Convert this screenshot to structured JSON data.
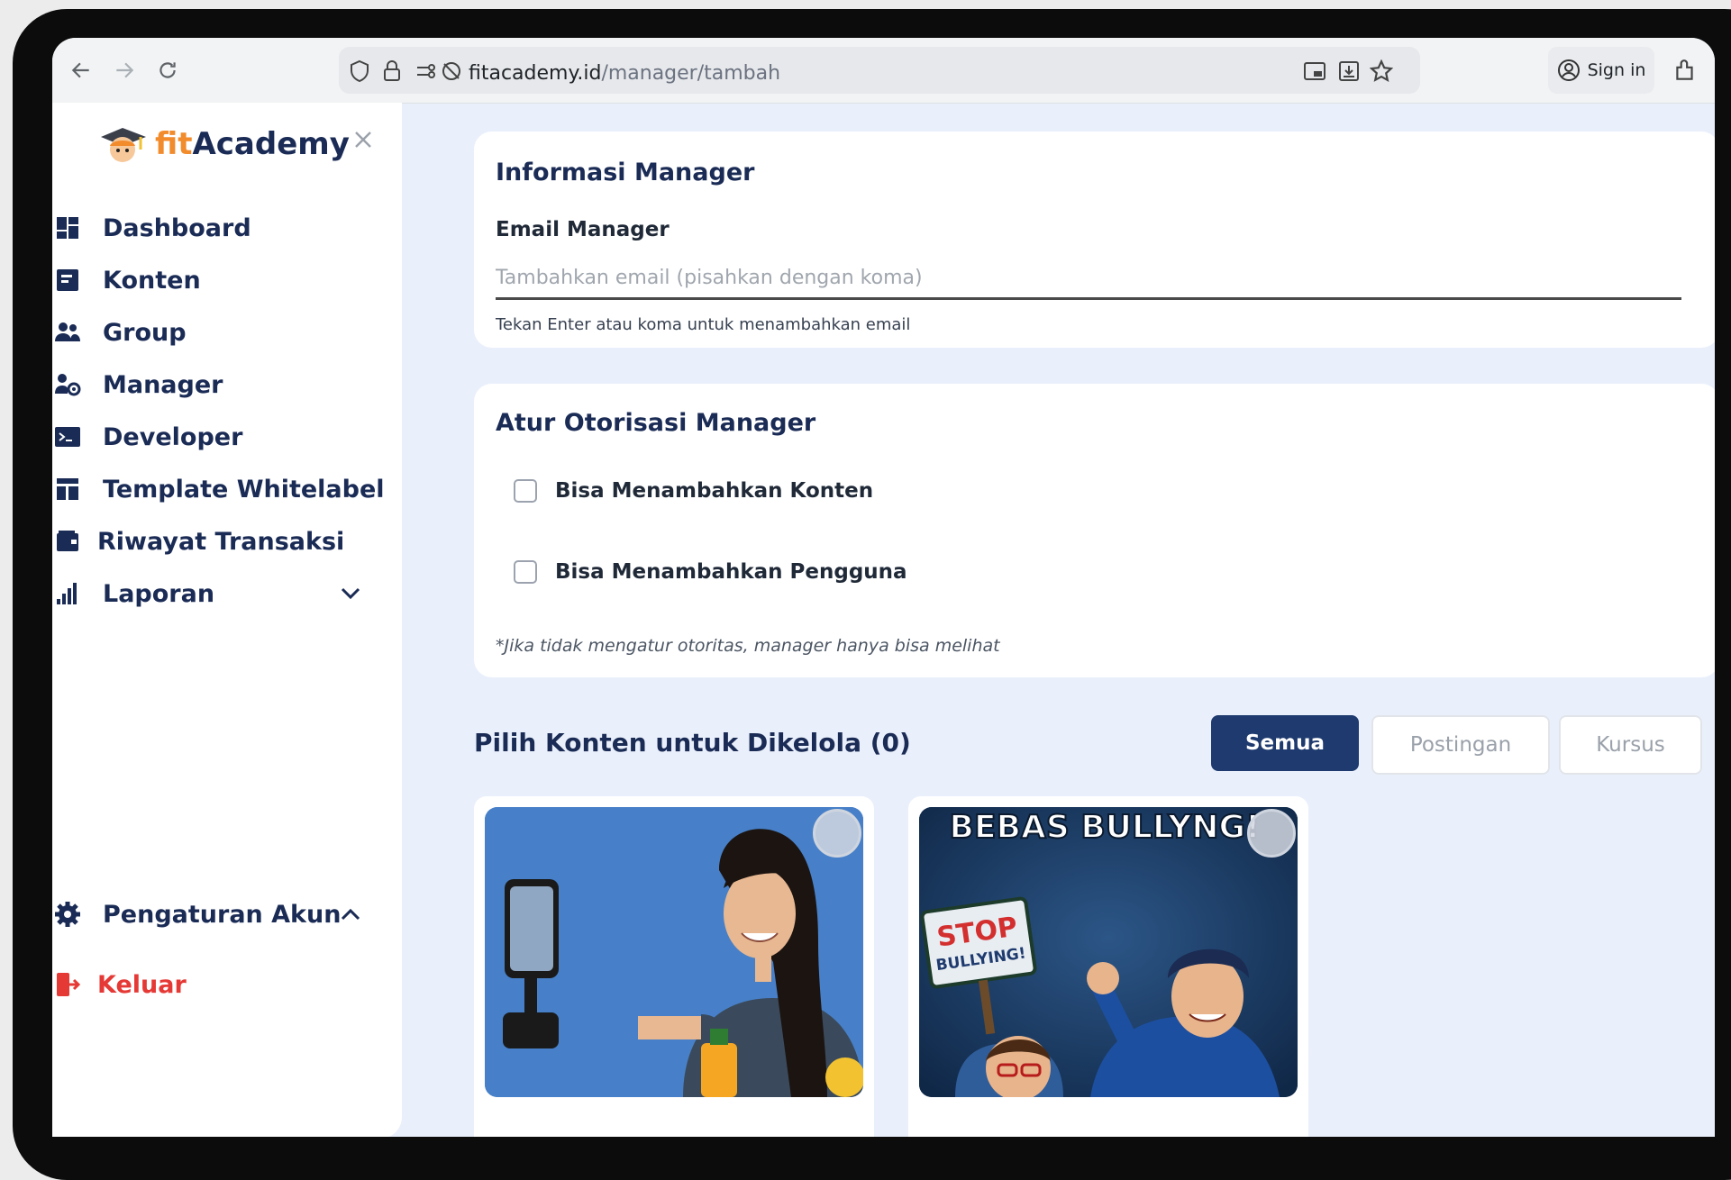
{
  "browser": {
    "url_domain": "fitacademy.id",
    "url_path": "/manager/tambah",
    "sign_in_label": "Sign in"
  },
  "sidebar": {
    "logo_fit": "fit",
    "logo_academy": "Academy",
    "items": [
      {
        "label": "Dashboard"
      },
      {
        "label": "Konten"
      },
      {
        "label": "Group"
      },
      {
        "label": "Manager"
      },
      {
        "label": "Developer"
      },
      {
        "label": "Template Whitelabel"
      },
      {
        "label": "Riwayat Transaksi"
      },
      {
        "label": "Laporan"
      }
    ],
    "account_label": "Pengaturan Akun",
    "logout_label": "Keluar"
  },
  "manager_info": {
    "title": "Informasi Manager",
    "email_label": "Email Manager",
    "email_placeholder": "Tambahkan email (pisahkan dengan koma)",
    "email_value": "",
    "hint": "Tekan Enter atau koma untuk menambahkan email"
  },
  "authorization": {
    "title": "Atur Otorisasi Manager",
    "options": [
      {
        "label": "Bisa Menambahkan Konten",
        "checked": false
      },
      {
        "label": "Bisa Menambahkan Pengguna",
        "checked": false
      }
    ],
    "note": "*Jika tidak mengatur otoritas, manager hanya bisa melihat"
  },
  "content_select": {
    "title": "Pilih Konten untuk Dikelola (0)",
    "filters": [
      {
        "label": "Semua",
        "active": true
      },
      {
        "label": "Postingan",
        "active": false
      },
      {
        "label": "Kursus",
        "active": false
      }
    ],
    "cards": [
      {
        "image": "woman-filming-with-phone"
      },
      {
        "image": "stop-bullying-illustration",
        "banner_text": "BEBAS BULLYNG!",
        "sign_text_1": "STOP",
        "sign_text_2": "BULLYING!"
      }
    ]
  },
  "colors": {
    "navy": "#1a2b55",
    "accent": "#f28b2c",
    "primary_button": "#1e3a6e",
    "danger": "#e53935",
    "background": "#eaf0fb"
  }
}
